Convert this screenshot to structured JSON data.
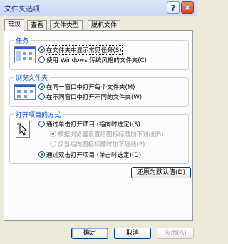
{
  "window": {
    "title": "文件夹选项"
  },
  "title_buttons": {
    "help": "?",
    "close": "×"
  },
  "tabs": [
    "常规",
    "查看",
    "文件类型",
    "脱机文件"
  ],
  "groups": {
    "tasks": {
      "title": "任务",
      "options": [
        {
          "label": "在文件夹中显示常见任务(S)",
          "checked": true
        },
        {
          "label": "使用 Windows 传统风格的文件夹(C)",
          "checked": false
        }
      ]
    },
    "browse": {
      "title": "浏览文件夹",
      "options": [
        {
          "label": "在同一窗口中打开每个文件夹(M)",
          "checked": true
        },
        {
          "label": "在不同窗口中打开不同的文件夹(W)",
          "checked": false
        }
      ]
    },
    "open": {
      "title": "打开项目的方式",
      "options": [
        {
          "label": "通过单击打开项目 (指向时选定)(S)",
          "checked": false
        },
        {
          "label": "根据浏览器设置给图标标题加下划线(B)",
          "checked": true,
          "disabled": true
        },
        {
          "label": "仅当指向图标标题时加下划线(P)",
          "checked": false,
          "disabled": true
        },
        {
          "label": "通过双击打开项目 (单击时选定)(D)",
          "checked": true
        }
      ]
    }
  },
  "buttons": {
    "restore_defaults": "还原为默认值(D)",
    "ok": "确定",
    "cancel": "取消",
    "apply": "应用(A)"
  }
}
